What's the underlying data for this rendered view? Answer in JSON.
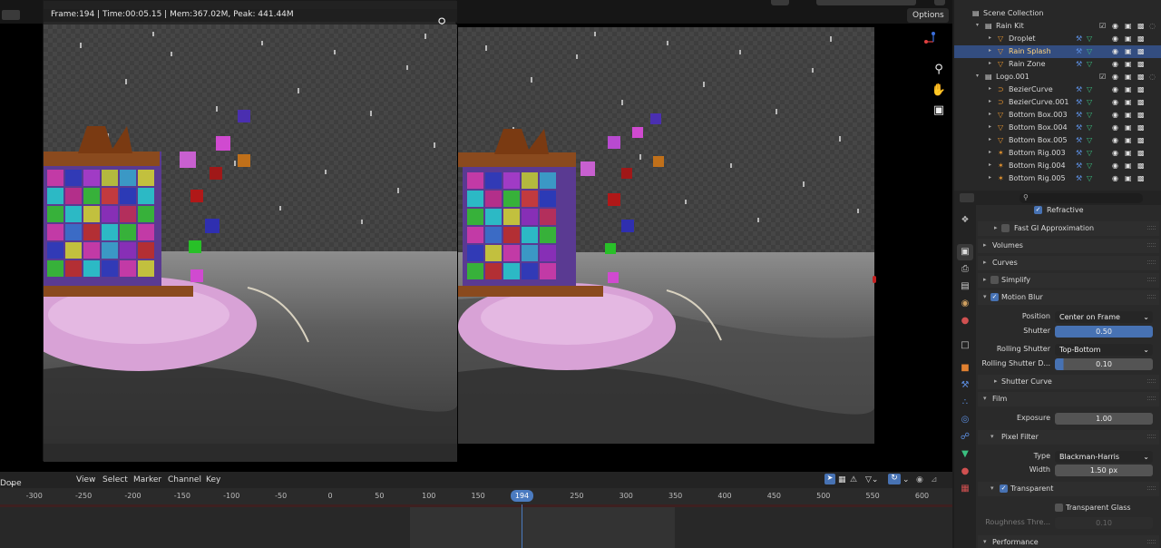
{
  "image_editor": {
    "info_text": "Frame:194 | Time:00:05.15 | Mem:367.02M, Peak: 441.44M"
  },
  "viewport": {
    "options_label": "Options"
  },
  "outliner": {
    "rows": [
      {
        "label": "Scene Collection",
        "indent": 0,
        "icon": "collection",
        "selected": false
      },
      {
        "label": "Rain Kit",
        "indent": 1,
        "icon": "collection",
        "selected": false
      },
      {
        "label": "Droplet",
        "indent": 2,
        "icon": "mesh",
        "selected": false
      },
      {
        "label": "Rain Splash",
        "indent": 2,
        "icon": "mesh",
        "selected": true
      },
      {
        "label": "Rain Zone",
        "indent": 2,
        "icon": "mesh",
        "selected": false
      },
      {
        "label": "Logo.001",
        "indent": 1,
        "icon": "collection",
        "selected": false
      },
      {
        "label": "BezierCurve",
        "indent": 2,
        "icon": "curve",
        "selected": false
      },
      {
        "label": "BezierCurve.001",
        "indent": 2,
        "icon": "curve",
        "selected": false
      },
      {
        "label": "Bottom Box.003",
        "indent": 2,
        "icon": "mesh",
        "selected": false
      },
      {
        "label": "Bottom Box.004",
        "indent": 2,
        "icon": "mesh",
        "selected": false
      },
      {
        "label": "Bottom Box.005",
        "indent": 2,
        "icon": "mesh",
        "selected": false
      },
      {
        "label": "Bottom Rig.003",
        "indent": 2,
        "icon": "armature",
        "selected": false
      },
      {
        "label": "Bottom Rig.004",
        "indent": 2,
        "icon": "armature",
        "selected": false
      },
      {
        "label": "Bottom Rig.005",
        "indent": 2,
        "icon": "armature",
        "selected": false
      }
    ]
  },
  "properties": {
    "refractive": "Refractive",
    "fast_gi": "Fast GI Approximation",
    "volumes": "Volumes",
    "curves": "Curves",
    "simplify": "Simplify",
    "motion_blur": "Motion Blur",
    "position_label": "Position",
    "position_value": "Center on Frame",
    "shutter_label": "Shutter",
    "shutter_value": "0.50",
    "rolling_shutter_label": "Rolling Shutter",
    "rolling_shutter_value": "Top-Bottom",
    "rolling_duration_label": "Rolling Shutter D...",
    "rolling_duration_value": "0.10",
    "shutter_curve": "Shutter Curve",
    "film": "Film",
    "exposure_label": "Exposure",
    "exposure_value": "1.00",
    "pixel_filter": "Pixel Filter",
    "type_label": "Type",
    "type_value": "Blackman-Harris",
    "width_label": "Width",
    "width_value": "1.50 px",
    "transparent": "Transparent",
    "transparent_glass": "Transparent Glass",
    "roughness_label": "Roughness Thre...",
    "roughness_value": "0.10",
    "performance": "Performance"
  },
  "dopesheet": {
    "editor_label": "Dope Sheet",
    "menu_view": "View",
    "menu_select": "Select",
    "menu_marker": "Marker",
    "menu_channel": "Channel",
    "menu_key": "Key",
    "ticks": [
      "-300",
      "-250",
      "-200",
      "-150",
      "-100",
      "-50",
      "0",
      "50",
      "100",
      "150",
      "250",
      "300",
      "350",
      "400",
      "450",
      "500",
      "550",
      "600"
    ],
    "current_frame": "194"
  }
}
